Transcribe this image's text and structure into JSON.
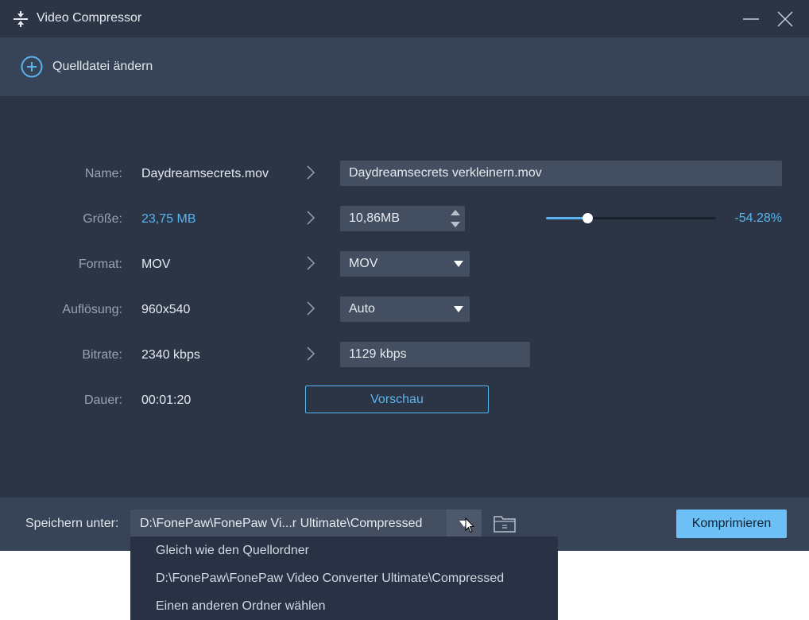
{
  "window": {
    "title": "Video Compressor"
  },
  "toolbar": {
    "change_source_label": "Quelldatei ändern"
  },
  "rows": {
    "name": {
      "label": "Name:",
      "source": "Daydreamsecrets.mov",
      "target": "Daydreamsecrets verkleinern.mov"
    },
    "size": {
      "label": "Größe:",
      "source": "23,75 MB",
      "target": "10,86MB",
      "slider_fraction": 0.2425,
      "percent": "-54.28%"
    },
    "format": {
      "label": "Format:",
      "source": "MOV",
      "target": "MOV"
    },
    "resolution": {
      "label": "Auflösung:",
      "source": "960x540",
      "target": "Auto"
    },
    "bitrate": {
      "label": "Bitrate:",
      "source": "2340 kbps",
      "target": "1129 kbps"
    },
    "duration": {
      "label": "Dauer:",
      "source": "00:01:20"
    }
  },
  "preview": {
    "label": "Vorschau"
  },
  "footer": {
    "save_label": "Speichern unter:",
    "path": "D:\\FonePaw\\FonePaw Vi...r Ultimate\\Compressed",
    "compress_label": "Komprimieren"
  },
  "dropdown": {
    "items": [
      "Gleich wie den Quellordner",
      "D:\\FonePaw\\FonePaw Video Converter Ultimate\\Compressed",
      "Einen anderen Ordner wählen"
    ]
  },
  "colors": {
    "accent": "#5ab4ef",
    "background": "#2b3546",
    "panel": "#374356",
    "field": "#434e61",
    "button": "#6cc0f5"
  },
  "icons": [
    "compress-app-icon",
    "minimize-icon",
    "close-icon",
    "add-circle-icon",
    "chevron-right-icon",
    "caret-down-icon",
    "spin-up-icon",
    "spin-down-icon",
    "folder-icon",
    "mouse-cursor-icon"
  ]
}
